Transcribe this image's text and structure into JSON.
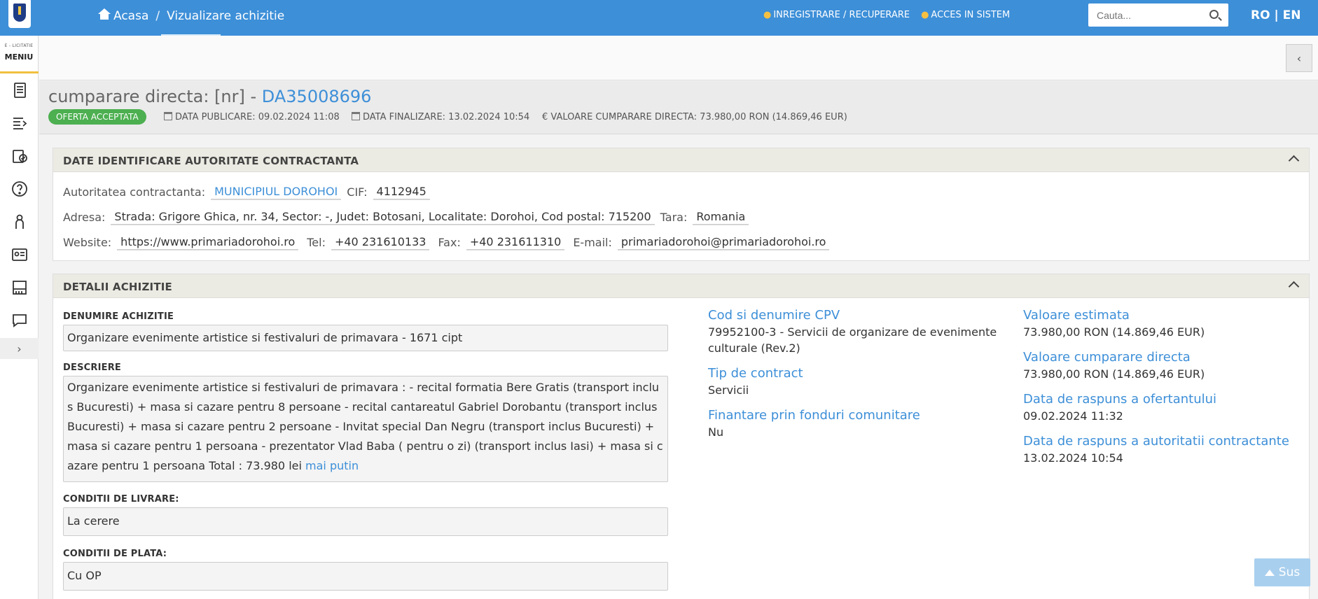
{
  "breadcrumb": {
    "home": "Acasa",
    "separator": "/",
    "current": "Vizualizare achizitie"
  },
  "top_links": {
    "register": "INREGISTRARE / RECUPERARE",
    "login": "ACCES IN SISTEM"
  },
  "search": {
    "placeholder": "Cauta..."
  },
  "lang": {
    "ro": "RO",
    "sep": "|",
    "en": "EN"
  },
  "sidebar": {
    "brand": "E - LICITATIE",
    "menu_label": "MENIU",
    "items": [
      "document-icon",
      "list-export-icon",
      "clipboard-check-icon",
      "help-icon",
      "user-icon",
      "id-card-icon",
      "building-icon",
      "chat-icon"
    ],
    "expand": "›"
  },
  "header": {
    "title_prefix": "cumparare directa: [nr] - ",
    "code": "DA35008696",
    "status": "OFERTA ACCEPTATA",
    "published": "DATA PUBLICARE: 09.02.2024 11:08",
    "finalized": "DATA FINALIZARE: 13.02.2024 10:54",
    "value": "€ VALOARE CUMPARARE DIRECTA: 73.980,00  RON (14.869,46  EUR)"
  },
  "authority": {
    "section_title": "DATE IDENTIFICARE AUTORITATE CONTRACTANTA",
    "name_label": "Autoritatea contractanta:",
    "name": "MUNICIPIUL DOROHOI",
    "cif_label": "CIF:",
    "cif": "4112945",
    "address_label": "Adresa:",
    "address": "Strada: Grigore Ghica, nr. 34, Sector: -, Judet: Botosani, Localitate: Dorohoi, Cod postal: 715200",
    "country_label": "Tara:",
    "country": "Romania",
    "website_label": "Website:",
    "website": "https://www.primariadorohoi.ro",
    "tel_label": "Tel:",
    "tel": "+40 231610133",
    "fax_label": "Fax:",
    "fax": "+40 231611310",
    "email_label": "E-mail:",
    "email": "primariadorohoi@primariadorohoi.ro"
  },
  "details": {
    "section_title": "DETALII ACHIZITIE",
    "name_label": "DENUMIRE ACHIZITIE",
    "name": "Organizare evenimente artistice si festivaluri de primavara - 1671 cipt",
    "desc_label": "DESCRIERE",
    "desc": "Organizare evenimente artistice si festivaluri de primavara : - recital formatia Bere Gratis (transport inclus Bucuresti) + masa si cazare pentru 8 persoane - recital cantareatul Gabriel Dorobantu (transport inclus Bucuresti) + masa si cazare pentru 2 persoane - Invitat special Dan Negru (transport inclus Bucuresti) + masa si cazare pentru 1 persoana - prezentator Vlad Baba ( pentru o zi) (transport inclus Iasi) + masa si cazare pentru 1 persoana Total : 73.980 lei",
    "desc_less": "mai putin",
    "delivery_label": "CONDITII DE LIVRARE:",
    "delivery": "La cerere",
    "payment_label": "CONDITII DE PLATA:",
    "payment": "Cu OP",
    "cpv_label": "Cod si denumire CPV",
    "cpv": "79952100-3 - Servicii de organizare de evenimente culturale (Rev.2)",
    "contract_type_label": "Tip de contract",
    "contract_type": "Servicii",
    "eu_funds_label": "Finantare prin fonduri comunitare",
    "eu_funds": "Nu",
    "estimated_label": "Valoare estimata",
    "estimated": "73.980,00  RON (14.869,46  EUR)",
    "direct_value_label": "Valoare cumparare directa",
    "direct_value": "73.980,00  RON (14.869,46  EUR)",
    "bidder_reply_label": "Data de raspuns a ofertantului",
    "bidder_reply": "09.02.2024 11:32",
    "authority_reply_label": "Data de raspuns a autoritatii contractante",
    "authority_reply": "13.02.2024 10:54"
  },
  "back_to_top": "Sus"
}
